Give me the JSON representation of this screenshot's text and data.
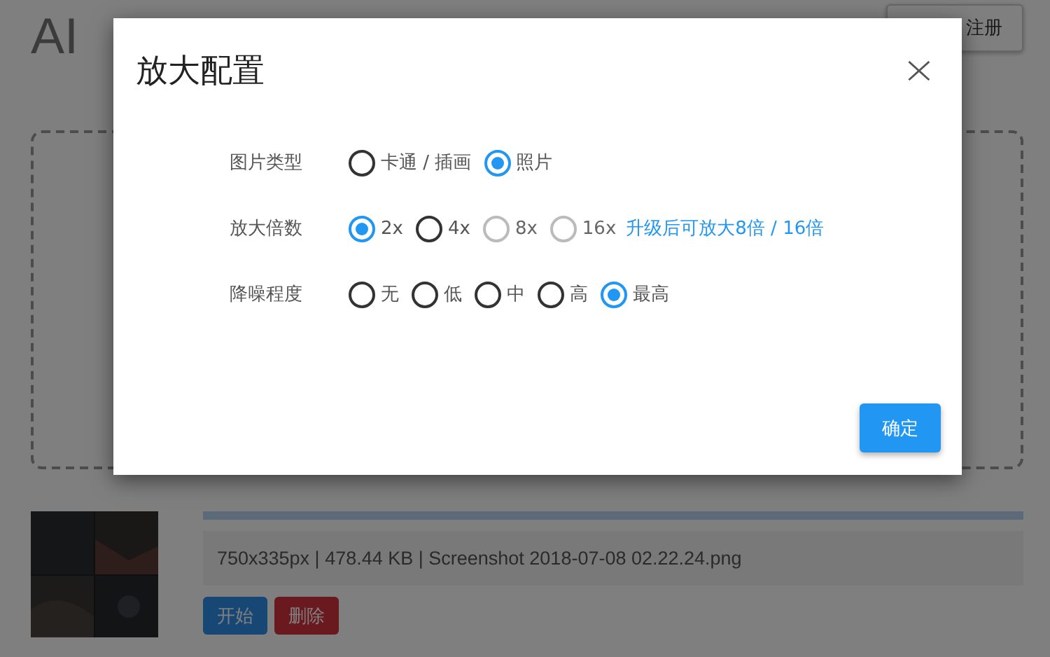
{
  "page": {
    "title": "AI",
    "register_button": "注册",
    "progress": {
      "level": 1
    },
    "file_info": "750x335px | 478.44 KB | Screenshot 2018-07-08 02.22.24.png",
    "start_button": "开始",
    "delete_button": "删除"
  },
  "dialog": {
    "title": "放大配置",
    "close": "×",
    "rows": [
      {
        "label": "图片类型",
        "options": [
          {
            "label": "卡通 / 插画",
            "selected": false,
            "disabled": false
          },
          {
            "label": "照片",
            "selected": true,
            "disabled": false
          }
        ]
      },
      {
        "label": "放大倍数",
        "options": [
          {
            "label": "2x",
            "selected": true,
            "disabled": false
          },
          {
            "label": "4x",
            "selected": false,
            "disabled": false
          },
          {
            "label": "8x",
            "selected": false,
            "disabled": true
          },
          {
            "label": "16x",
            "selected": false,
            "disabled": true
          }
        ],
        "link": "升级后可放大8倍 / 16倍"
      },
      {
        "label": "降噪程度",
        "options": [
          {
            "label": "无",
            "selected": false,
            "disabled": false
          },
          {
            "label": "低",
            "selected": false,
            "disabled": false
          },
          {
            "label": "中",
            "selected": false,
            "disabled": false
          },
          {
            "label": "高",
            "selected": false,
            "disabled": false
          },
          {
            "label": "最高",
            "selected": true,
            "disabled": false
          }
        ]
      }
    ],
    "confirm_button": "确定"
  }
}
